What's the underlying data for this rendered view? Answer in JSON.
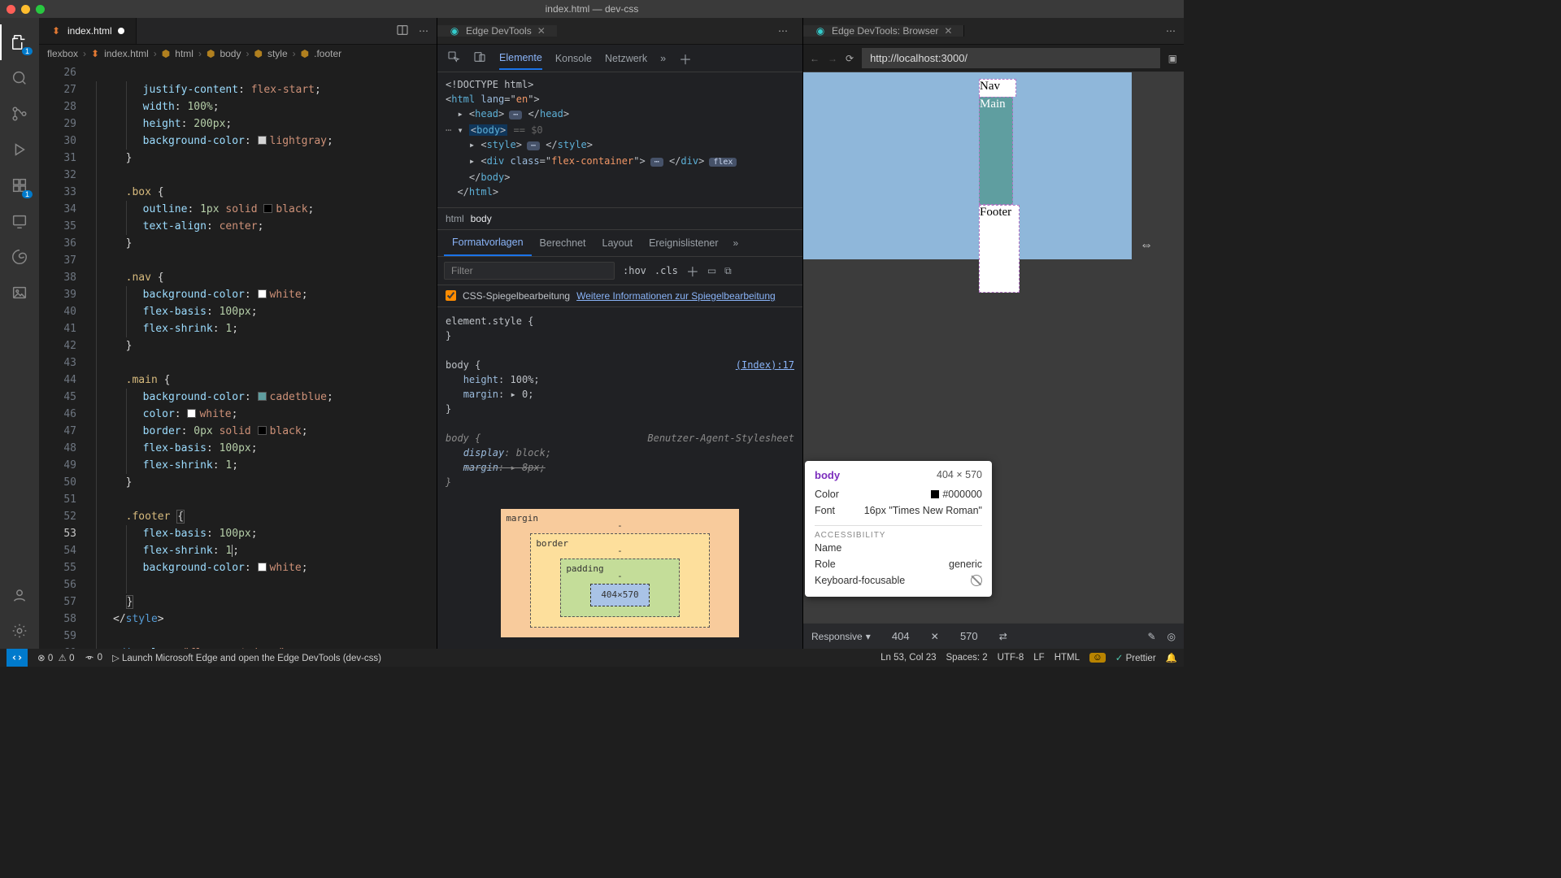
{
  "window": {
    "title": "index.html — dev-css"
  },
  "activity": {
    "explorer_badge": "1",
    "ext_badge": "1"
  },
  "editor": {
    "tab": "index.html",
    "breadcrumb": [
      "flexbox",
      "index.html",
      "html",
      "body",
      "style",
      ".footer"
    ],
    "gutter_start": 27,
    "active_line": 53
  },
  "devtoolsPanel": {
    "tab": "Edge DevTools",
    "tabs": [
      "Elemente",
      "Konsole",
      "Netzwerk"
    ],
    "crumbs": [
      "html",
      "body"
    ],
    "stylesTabs": [
      "Formatvorlagen",
      "Berechnet",
      "Layout",
      "Ereignislistener"
    ],
    "filter": "Filter",
    "hov": ":hov",
    "cls": ".cls",
    "mirrorLabel": "CSS-Spiegelbearbeitung",
    "mirrorLink": "Weitere Informationen zur Spiegelbearbeitung",
    "sourceLink": "(Index):17",
    "uaLabel": "Benutzer-Agent-Stylesheet",
    "boxModel": {
      "margin": "margin",
      "border": "border",
      "padding": "padding",
      "content": "404×570"
    }
  },
  "browser": {
    "tab": "Edge DevTools: Browser",
    "url": "http://localhost:3000/",
    "nav": "Nav",
    "main": "Main",
    "footer": "Footer"
  },
  "tooltip": {
    "title": "body",
    "dims": "404 × 570",
    "colorLabel": "Color",
    "colorVal": "#000000",
    "fontLabel": "Font",
    "fontVal": "16px \"Times New Roman\"",
    "accHdr": "ACCESSIBILITY",
    "nameLabel": "Name",
    "roleLabel": "Role",
    "roleVal": "generic",
    "kfLabel": "Keyboard-focusable"
  },
  "devbar": {
    "mode": "Responsive",
    "w": "404",
    "h": "570"
  },
  "status": {
    "errors": "0",
    "warnings": "0",
    "ports": "0",
    "launch": "Launch Microsoft Edge and open the Edge DevTools (dev-css)",
    "lncol": "Ln 53, Col 23",
    "spaces": "Spaces: 2",
    "enc": "UTF-8",
    "eol": "LF",
    "lang": "HTML",
    "prettier": "Prettier"
  }
}
